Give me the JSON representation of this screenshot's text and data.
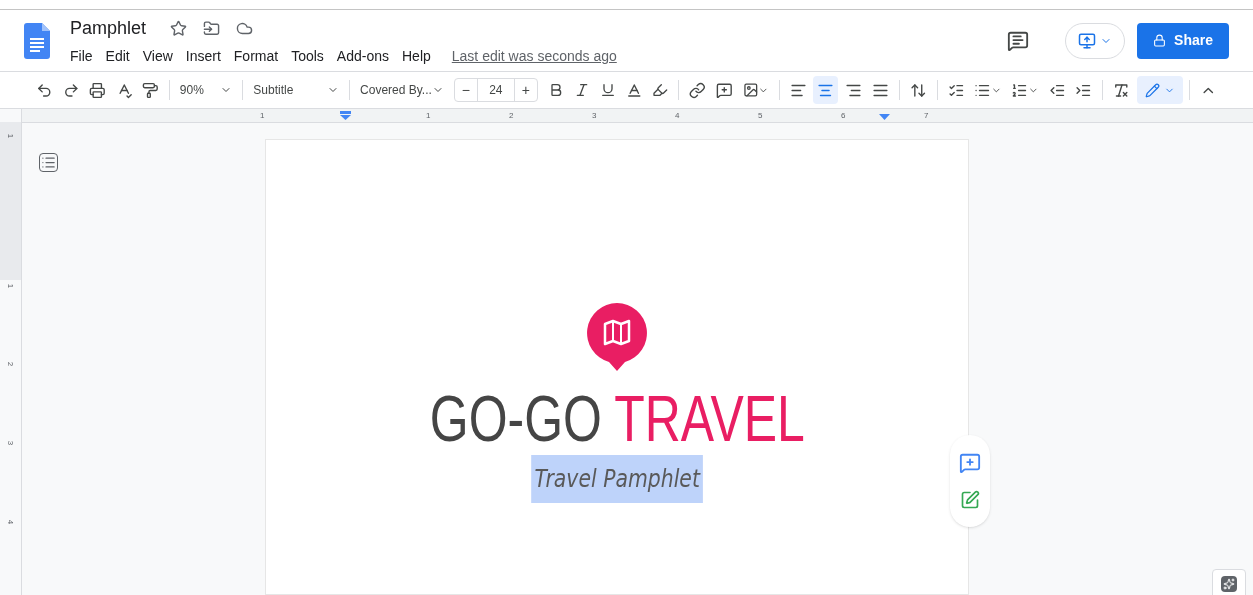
{
  "doc": {
    "title": "Pamphlet",
    "last_edit": "Last edit was seconds ago",
    "share": "Share"
  },
  "menu": [
    "File",
    "Edit",
    "View",
    "Insert",
    "Format",
    "Tools",
    "Add-ons",
    "Help"
  ],
  "toolbar": {
    "zoom": "90%",
    "style": "Subtitle",
    "font": "Covered By...",
    "font_size": "24",
    "minus": "−",
    "plus": "+",
    "alignments": [
      {
        "kind": "left",
        "selected": false
      },
      {
        "kind": "center",
        "selected": true
      },
      {
        "kind": "right",
        "selected": false
      },
      {
        "kind": "justify",
        "selected": false
      }
    ],
    "editing_mode": {
      "selected": true
    }
  },
  "ruler": {
    "horizontal": [
      "1",
      "1",
      "2",
      "3",
      "4",
      "5",
      "6",
      "7"
    ],
    "vertical": [
      "1",
      "1",
      "2",
      "3",
      "4"
    ]
  },
  "page": {
    "heading": [
      {
        "text": "GO-GO",
        "color": "#454545"
      },
      {
        "text": "TRAVEL",
        "color": "#e91e63"
      }
    ],
    "subtitle": {
      "text": "Travel Pamphlet",
      "selected": true
    }
  }
}
